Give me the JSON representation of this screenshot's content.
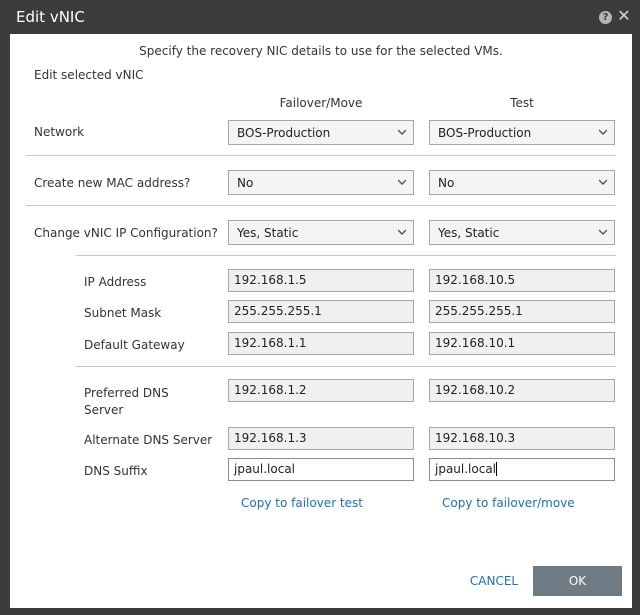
{
  "dialog": {
    "title": "Edit vNIC",
    "help_symbol": "?",
    "close_symbol": "✕",
    "intro": "Specify the recovery NIC details to use for the selected VMs.",
    "section_label": "Edit selected vNIC"
  },
  "columns": {
    "failover": "Failover/Move",
    "test": "Test"
  },
  "rows": {
    "network": {
      "label": "Network",
      "failover": "BOS-Production",
      "test": "BOS-Production"
    },
    "mac": {
      "label": "Create new MAC address?",
      "failover": "No",
      "test": "No"
    },
    "ipconfig": {
      "label": "Change vNIC IP Configuration?",
      "failover": "Yes, Static",
      "test": "Yes, Static"
    }
  },
  "fields": {
    "ip": {
      "label": "IP Address",
      "failover": "192.168.1.5",
      "test": "192.168.10.5"
    },
    "subnet": {
      "label": "Subnet Mask",
      "failover": "255.255.255.1",
      "test": "255.255.255.1"
    },
    "gateway": {
      "label": "Default Gateway",
      "failover": "192.168.1.1",
      "test": "192.168.10.1"
    },
    "dns1": {
      "label_line1": "Preferred DNS",
      "label_line2": "Server",
      "failover": "192.168.1.2",
      "test": "192.168.10.2"
    },
    "dns2": {
      "label": "Alternate DNS Server",
      "failover": "192.168.1.3",
      "test": "192.168.10.3"
    },
    "suffix": {
      "label": "DNS Suffix",
      "failover": "jpaul.local",
      "test": "jpaul.local"
    }
  },
  "links": {
    "copy_to_test": "Copy to failover test",
    "copy_to_failover": "Copy to failover/move"
  },
  "buttons": {
    "cancel": "CANCEL",
    "ok": "OK"
  },
  "colors": {
    "titlebar": "#3c3c3c",
    "link": "#1f6fb2",
    "ok_button": "#6e7b85"
  }
}
